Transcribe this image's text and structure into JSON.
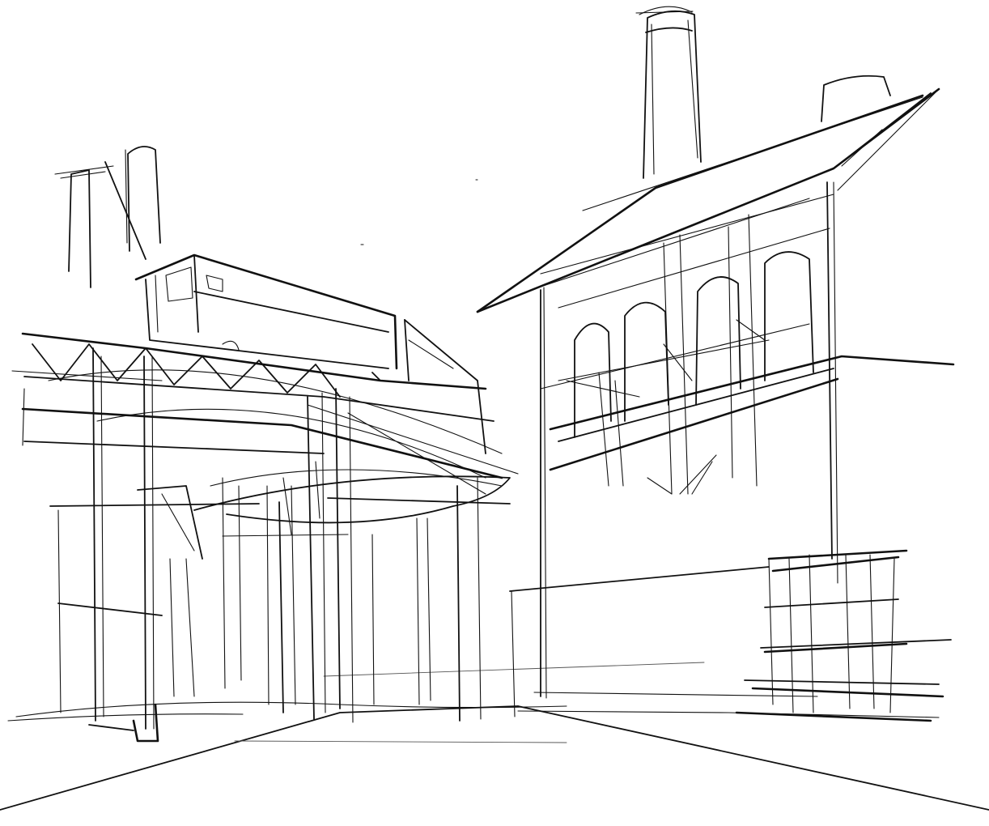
{
  "image": {
    "kind": "pencil-sketch",
    "background_color": "#ffffff",
    "ink_color": "#111111",
    "faint_ink_color": "#555555"
  }
}
